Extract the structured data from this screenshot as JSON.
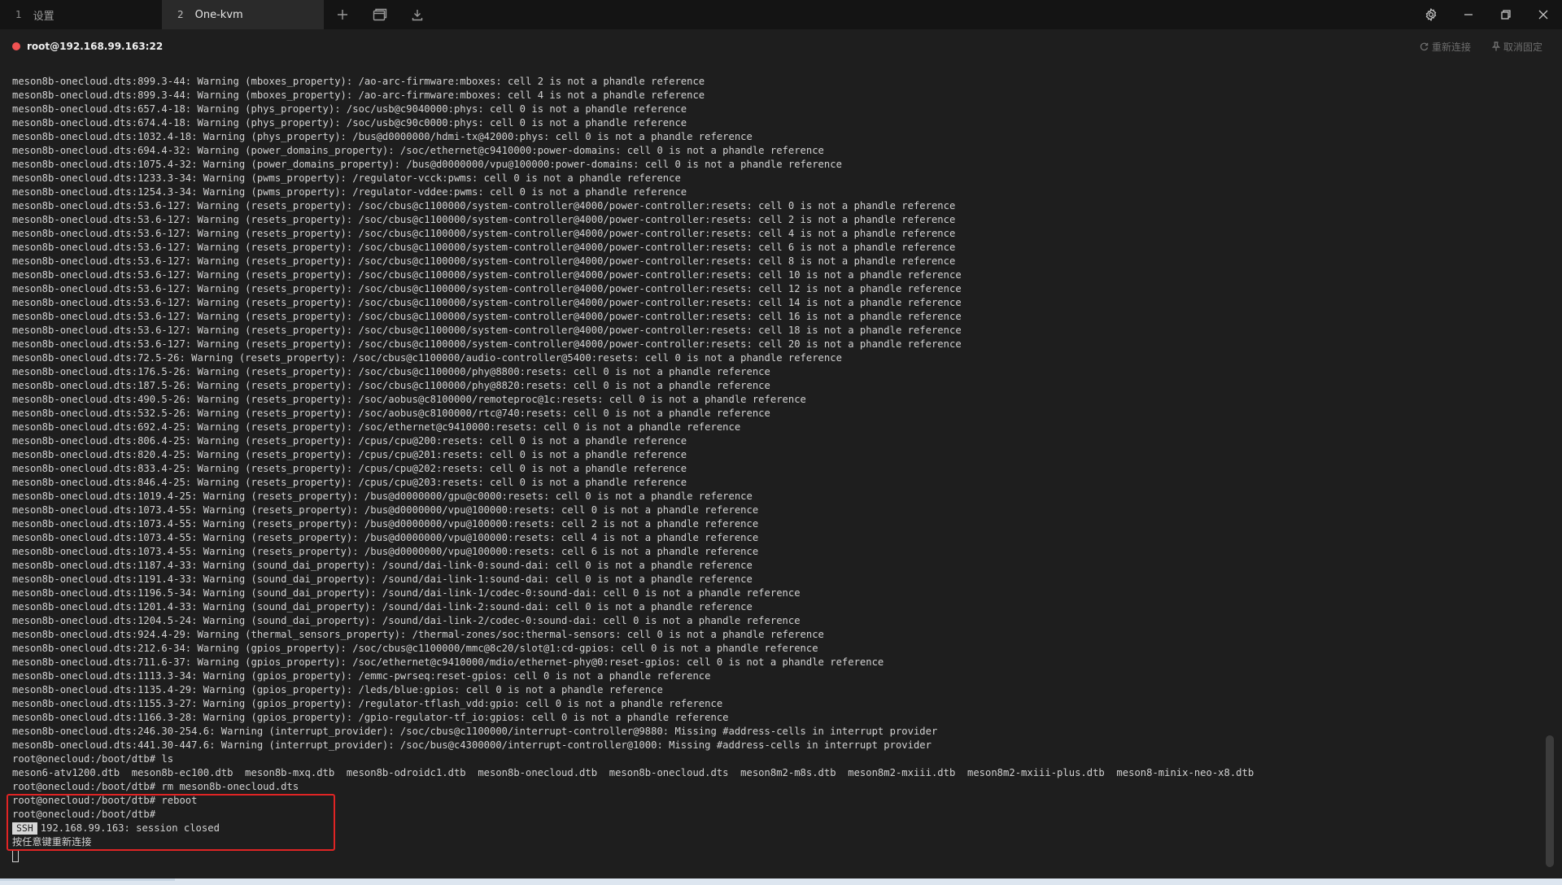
{
  "tabs": [
    {
      "number": "1",
      "label": "设置",
      "active": false
    },
    {
      "number": "2",
      "label": "One-kvm",
      "active": true
    }
  ],
  "toolbar": {
    "new_tab_icon": "plus-icon",
    "window_icon": "window-icon",
    "download_icon": "download-icon"
  },
  "window": {
    "settings_icon": "gear-icon",
    "minimize_icon": "minimize-icon",
    "restore_icon": "restore-icon",
    "close_icon": "close-icon"
  },
  "session": {
    "status_color": "#f05252",
    "host": "root@192.168.99.163:22",
    "reconnect_label": "重新连接",
    "unpin_label": "取消固定"
  },
  "terminal": {
    "lines": [
      "meson8b-onecloud.dts:899.3-44: Warning (mboxes_property): /ao-arc-firmware:mboxes: cell 2 is not a phandle reference",
      "meson8b-onecloud.dts:899.3-44: Warning (mboxes_property): /ao-arc-firmware:mboxes: cell 4 is not a phandle reference",
      "meson8b-onecloud.dts:657.4-18: Warning (phys_property): /soc/usb@c9040000:phys: cell 0 is not a phandle reference",
      "meson8b-onecloud.dts:674.4-18: Warning (phys_property): /soc/usb@c90c0000:phys: cell 0 is not a phandle reference",
      "meson8b-onecloud.dts:1032.4-18: Warning (phys_property): /bus@d0000000/hdmi-tx@42000:phys: cell 0 is not a phandle reference",
      "meson8b-onecloud.dts:694.4-32: Warning (power_domains_property): /soc/ethernet@c9410000:power-domains: cell 0 is not a phandle reference",
      "meson8b-onecloud.dts:1075.4-32: Warning (power_domains_property): /bus@d0000000/vpu@100000:power-domains: cell 0 is not a phandle reference",
      "meson8b-onecloud.dts:1233.3-34: Warning (pwms_property): /regulator-vcck:pwms: cell 0 is not a phandle reference",
      "meson8b-onecloud.dts:1254.3-34: Warning (pwms_property): /regulator-vddee:pwms: cell 0 is not a phandle reference",
      "meson8b-onecloud.dts:53.6-127: Warning (resets_property): /soc/cbus@c1100000/system-controller@4000/power-controller:resets: cell 0 is not a phandle reference",
      "meson8b-onecloud.dts:53.6-127: Warning (resets_property): /soc/cbus@c1100000/system-controller@4000/power-controller:resets: cell 2 is not a phandle reference",
      "meson8b-onecloud.dts:53.6-127: Warning (resets_property): /soc/cbus@c1100000/system-controller@4000/power-controller:resets: cell 4 is not a phandle reference",
      "meson8b-onecloud.dts:53.6-127: Warning (resets_property): /soc/cbus@c1100000/system-controller@4000/power-controller:resets: cell 6 is not a phandle reference",
      "meson8b-onecloud.dts:53.6-127: Warning (resets_property): /soc/cbus@c1100000/system-controller@4000/power-controller:resets: cell 8 is not a phandle reference",
      "meson8b-onecloud.dts:53.6-127: Warning (resets_property): /soc/cbus@c1100000/system-controller@4000/power-controller:resets: cell 10 is not a phandle reference",
      "meson8b-onecloud.dts:53.6-127: Warning (resets_property): /soc/cbus@c1100000/system-controller@4000/power-controller:resets: cell 12 is not a phandle reference",
      "meson8b-onecloud.dts:53.6-127: Warning (resets_property): /soc/cbus@c1100000/system-controller@4000/power-controller:resets: cell 14 is not a phandle reference",
      "meson8b-onecloud.dts:53.6-127: Warning (resets_property): /soc/cbus@c1100000/system-controller@4000/power-controller:resets: cell 16 is not a phandle reference",
      "meson8b-onecloud.dts:53.6-127: Warning (resets_property): /soc/cbus@c1100000/system-controller@4000/power-controller:resets: cell 18 is not a phandle reference",
      "meson8b-onecloud.dts:53.6-127: Warning (resets_property): /soc/cbus@c1100000/system-controller@4000/power-controller:resets: cell 20 is not a phandle reference",
      "meson8b-onecloud.dts:72.5-26: Warning (resets_property): /soc/cbus@c1100000/audio-controller@5400:resets: cell 0 is not a phandle reference",
      "meson8b-onecloud.dts:176.5-26: Warning (resets_property): /soc/cbus@c1100000/phy@8800:resets: cell 0 is not a phandle reference",
      "meson8b-onecloud.dts:187.5-26: Warning (resets_property): /soc/cbus@c1100000/phy@8820:resets: cell 0 is not a phandle reference",
      "meson8b-onecloud.dts:490.5-26: Warning (resets_property): /soc/aobus@c8100000/remoteproc@1c:resets: cell 0 is not a phandle reference",
      "meson8b-onecloud.dts:532.5-26: Warning (resets_property): /soc/aobus@c8100000/rtc@740:resets: cell 0 is not a phandle reference",
      "meson8b-onecloud.dts:692.4-25: Warning (resets_property): /soc/ethernet@c9410000:resets: cell 0 is not a phandle reference",
      "meson8b-onecloud.dts:806.4-25: Warning (resets_property): /cpus/cpu@200:resets: cell 0 is not a phandle reference",
      "meson8b-onecloud.dts:820.4-25: Warning (resets_property): /cpus/cpu@201:resets: cell 0 is not a phandle reference",
      "meson8b-onecloud.dts:833.4-25: Warning (resets_property): /cpus/cpu@202:resets: cell 0 is not a phandle reference",
      "meson8b-onecloud.dts:846.4-25: Warning (resets_property): /cpus/cpu@203:resets: cell 0 is not a phandle reference",
      "meson8b-onecloud.dts:1019.4-25: Warning (resets_property): /bus@d0000000/gpu@c0000:resets: cell 0 is not a phandle reference",
      "meson8b-onecloud.dts:1073.4-55: Warning (resets_property): /bus@d0000000/vpu@100000:resets: cell 0 is not a phandle reference",
      "meson8b-onecloud.dts:1073.4-55: Warning (resets_property): /bus@d0000000/vpu@100000:resets: cell 2 is not a phandle reference",
      "meson8b-onecloud.dts:1073.4-55: Warning (resets_property): /bus@d0000000/vpu@100000:resets: cell 4 is not a phandle reference",
      "meson8b-onecloud.dts:1073.4-55: Warning (resets_property): /bus@d0000000/vpu@100000:resets: cell 6 is not a phandle reference",
      "meson8b-onecloud.dts:1187.4-33: Warning (sound_dai_property): /sound/dai-link-0:sound-dai: cell 0 is not a phandle reference",
      "meson8b-onecloud.dts:1191.4-33: Warning (sound_dai_property): /sound/dai-link-1:sound-dai: cell 0 is not a phandle reference",
      "meson8b-onecloud.dts:1196.5-34: Warning (sound_dai_property): /sound/dai-link-1/codec-0:sound-dai: cell 0 is not a phandle reference",
      "meson8b-onecloud.dts:1201.4-33: Warning (sound_dai_property): /sound/dai-link-2:sound-dai: cell 0 is not a phandle reference",
      "meson8b-onecloud.dts:1204.5-24: Warning (sound_dai_property): /sound/dai-link-2/codec-0:sound-dai: cell 0 is not a phandle reference",
      "meson8b-onecloud.dts:924.4-29: Warning (thermal_sensors_property): /thermal-zones/soc:thermal-sensors: cell 0 is not a phandle reference",
      "meson8b-onecloud.dts:212.6-34: Warning (gpios_property): /soc/cbus@c1100000/mmc@8c20/slot@1:cd-gpios: cell 0 is not a phandle reference",
      "meson8b-onecloud.dts:711.6-37: Warning (gpios_property): /soc/ethernet@c9410000/mdio/ethernet-phy@0:reset-gpios: cell 0 is not a phandle reference",
      "meson8b-onecloud.dts:1113.3-34: Warning (gpios_property): /emmc-pwrseq:reset-gpios: cell 0 is not a phandle reference",
      "meson8b-onecloud.dts:1135.4-29: Warning (gpios_property): /leds/blue:gpios: cell 0 is not a phandle reference",
      "meson8b-onecloud.dts:1155.3-27: Warning (gpios_property): /regulator-tflash_vdd:gpio: cell 0 is not a phandle reference",
      "meson8b-onecloud.dts:1166.3-28: Warning (gpios_property): /gpio-regulator-tf_io:gpios: cell 0 is not a phandle reference",
      "meson8b-onecloud.dts:246.30-254.6: Warning (interrupt_provider): /soc/cbus@c1100000/interrupt-controller@9880: Missing #address-cells in interrupt provider",
      "meson8b-onecloud.dts:441.30-447.6: Warning (interrupt_provider): /soc/bus@c4300000/interrupt-controller@1000: Missing #address-cells in interrupt provider",
      "root@onecloud:/boot/dtb# ls",
      "meson6-atv1200.dtb  meson8b-ec100.dtb  meson8b-mxq.dtb  meson8b-odroidc1.dtb  meson8b-onecloud.dtb  meson8b-onecloud.dts  meson8m2-m8s.dtb  meson8m2-mxiii.dtb  meson8m2-mxiii-plus.dtb  meson8-minix-neo-x8.dtb",
      "root@onecloud:/boot/dtb# rm meson8b-onecloud.dts",
      "root@onecloud:/boot/dtb# reboot",
      "root@onecloud:/boot/dtb#"
    ],
    "ssh_badge": "SSH",
    "session_closed": "192.168.99.163: session closed",
    "reconnect_prompt": "按任意键重新连接",
    "highlight_color": "#e02424"
  }
}
